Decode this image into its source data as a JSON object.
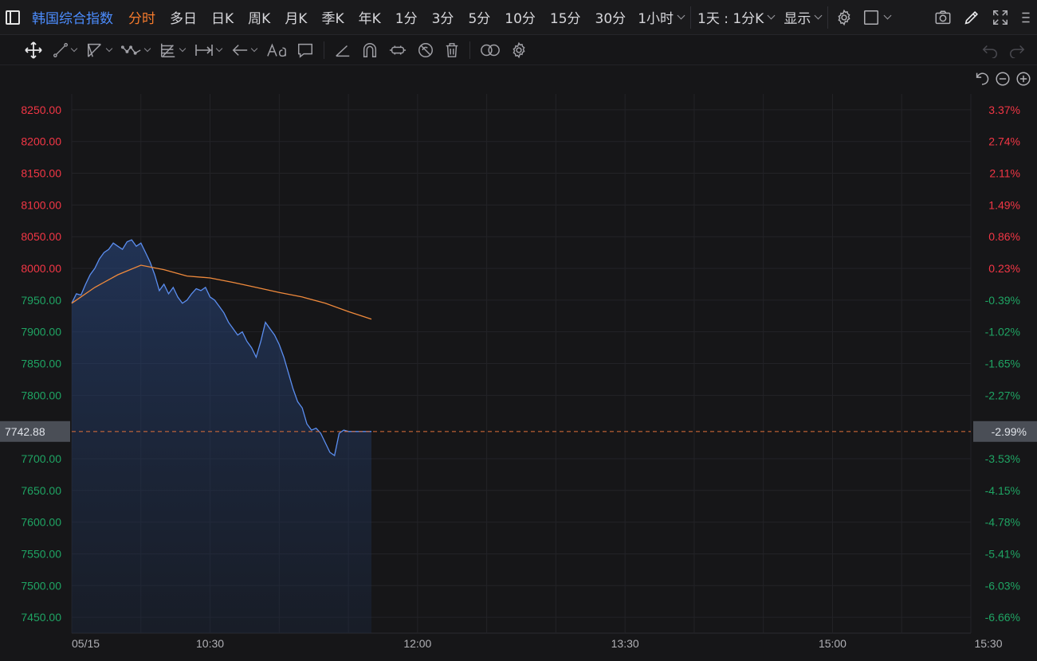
{
  "header": {
    "index_title": "韩国综合指数",
    "tabs": [
      {
        "label": "分时",
        "active": true
      },
      {
        "label": "多日",
        "active": false
      },
      {
        "label": "日K",
        "active": false
      },
      {
        "label": "周K",
        "active": false
      },
      {
        "label": "月K",
        "active": false
      },
      {
        "label": "季K",
        "active": false
      },
      {
        "label": "年K",
        "active": false
      },
      {
        "label": "1分",
        "active": false
      },
      {
        "label": "3分",
        "active": false
      },
      {
        "label": "5分",
        "active": false
      },
      {
        "label": "10分",
        "active": false
      },
      {
        "label": "15分",
        "active": false
      },
      {
        "label": "30分",
        "active": false
      }
    ],
    "interval_dropdown": "1小时",
    "period_dropdown": "1天 : 1分K",
    "display_dropdown": "显示"
  },
  "colors": {
    "accent_blue": "#4c8dff",
    "active_tab": "#f57a2c",
    "up_red": "#f23645",
    "down_green": "#1fa463",
    "avg_line": "#f08a3c",
    "price_line": "#5b8ef0",
    "current_price_line": "#e0703a"
  },
  "chart_data": {
    "type": "area",
    "y_left_labels": [
      "8250.00",
      "8200.00",
      "8150.00",
      "8100.00",
      "8050.00",
      "8000.00",
      "7950.00",
      "7900.00",
      "7850.00",
      "7800.00",
      "7700.00",
      "7650.00",
      "7600.00",
      "7550.00",
      "7500.00",
      "7450.00"
    ],
    "y_right_labels": [
      "3.37%",
      "2.74%",
      "2.11%",
      "1.49%",
      "0.86%",
      "0.23%",
      "-0.39%",
      "-1.02%",
      "-1.65%",
      "-2.27%",
      "-3.53%",
      "-4.15%",
      "-4.78%",
      "-5.41%",
      "-6.03%",
      "-6.66%"
    ],
    "x_labels": [
      "05/15",
      "10:30",
      "12:00",
      "13:30",
      "15:00",
      "15:30"
    ],
    "ylim": [
      7425,
      8275
    ],
    "current_price": "7742.88",
    "current_change": "-2.99%",
    "session_minutes": 390,
    "price_minutes": [
      0,
      2,
      4,
      6,
      8,
      10,
      12,
      14,
      16,
      18,
      20,
      22,
      24,
      26,
      28,
      30,
      32,
      34,
      36,
      38,
      40,
      42,
      44,
      46,
      48,
      50,
      52,
      54,
      56,
      58,
      60,
      62,
      64,
      66,
      68,
      70,
      72,
      74,
      76,
      78,
      80,
      82,
      84,
      86,
      88,
      90,
      92,
      94,
      96,
      98,
      100,
      102,
      104,
      106,
      108,
      110,
      112,
      114,
      116,
      118,
      120,
      122,
      124,
      126,
      128,
      130
    ],
    "price_values": [
      7945,
      7960,
      7958,
      7975,
      7990,
      8000,
      8015,
      8025,
      8030,
      8040,
      8035,
      8030,
      8042,
      8045,
      8035,
      8040,
      8025,
      8010,
      7990,
      7965,
      7975,
      7960,
      7970,
      7955,
      7945,
      7950,
      7960,
      7968,
      7965,
      7970,
      7955,
      7950,
      7940,
      7930,
      7915,
      7905,
      7895,
      7900,
      7885,
      7875,
      7860,
      7885,
      7915,
      7905,
      7895,
      7880,
      7860,
      7835,
      7810,
      7790,
      7780,
      7755,
      7745,
      7748,
      7740,
      7725,
      7710,
      7705,
      7740,
      7745,
      7742.88,
      7742.88,
      7742.88,
      7742.88,
      7742.88,
      7742.88
    ],
    "avg_minutes": [
      0,
      10,
      20,
      30,
      40,
      50,
      60,
      70,
      80,
      90,
      100,
      110,
      120,
      130
    ],
    "avg_values": [
      7945,
      7970,
      7990,
      8005,
      7998,
      7988,
      7985,
      7978,
      7970,
      7962,
      7955,
      7945,
      7932,
      7920
    ]
  }
}
